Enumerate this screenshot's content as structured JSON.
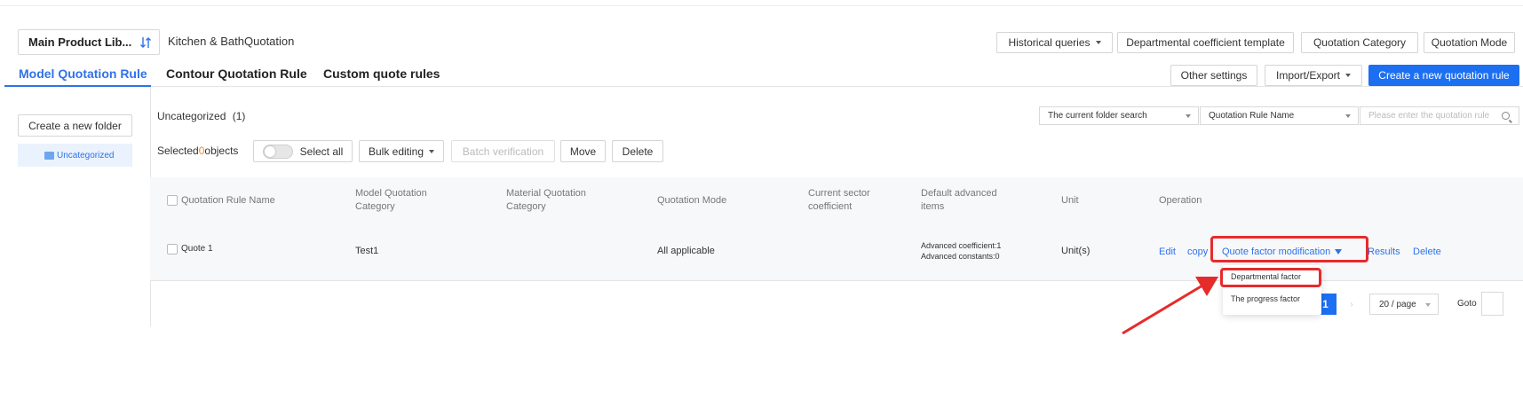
{
  "header": {
    "library_select": "Main Product Lib...",
    "breadcrumb": "Kitchen & BathQuotation",
    "top_buttons": [
      "Historical queries",
      "Departmental coefficient template",
      "Quotation Category",
      "Quotation Mode"
    ]
  },
  "tabs": [
    "Model Quotation Rule",
    "Contour Quotation Rule",
    "Custom quote rules"
  ],
  "actions": {
    "other_settings": "Other settings",
    "import_export": "Import/Export",
    "create_rule": "Create a new quotation rule"
  },
  "sidebar": {
    "create_folder": "Create a new folder",
    "folder": "Uncategorized"
  },
  "toolbar": {
    "folder_title": "Uncategorized",
    "folder_count": "(1)",
    "search_scope": "The current folder search",
    "search_field": "Quotation Rule Name",
    "search_placeholder": "Please enter the quotation rule",
    "selected_prefix": "Selected",
    "selected_count": "0",
    "selected_suffix": "objects",
    "select_all": "Select all",
    "bulk_editing": "Bulk editing",
    "batch_verification": "Batch verification",
    "move": "Move",
    "delete": "Delete"
  },
  "table": {
    "headers": {
      "name": "Quotation Rule Name",
      "model_cat_1": "Model Quotation",
      "model_cat_2": "Category",
      "material_cat_1": "Material Quotation",
      "material_cat_2": "Category",
      "mode": "Quotation Mode",
      "sector_1": "Current sector",
      "sector_2": "coefficient",
      "advanced_1": "Default advanced",
      "advanced_2": "items",
      "unit": "Unit",
      "operation": "Operation"
    },
    "row": {
      "name": "Quote 1",
      "model_category": "Test1",
      "mode": "All applicable",
      "advanced_coefficient": "Advanced coefficient:1",
      "advanced_constants": "Advanced constants:0",
      "unit": "Unit(s)",
      "ops": {
        "edit": "Edit",
        "copy": "copy",
        "factor": "Quote factor modification",
        "results": "Results",
        "delete": "Delete"
      }
    }
  },
  "dropdown": {
    "items": [
      "Departmental factor",
      "The progress factor"
    ]
  },
  "pagination": {
    "current": "1",
    "next": "›",
    "page_size": "20 / page",
    "goto": "Goto"
  },
  "colors": {
    "accent": "#1d6ff2",
    "highlight": "#e62b2b",
    "count": "#f28c1e"
  }
}
